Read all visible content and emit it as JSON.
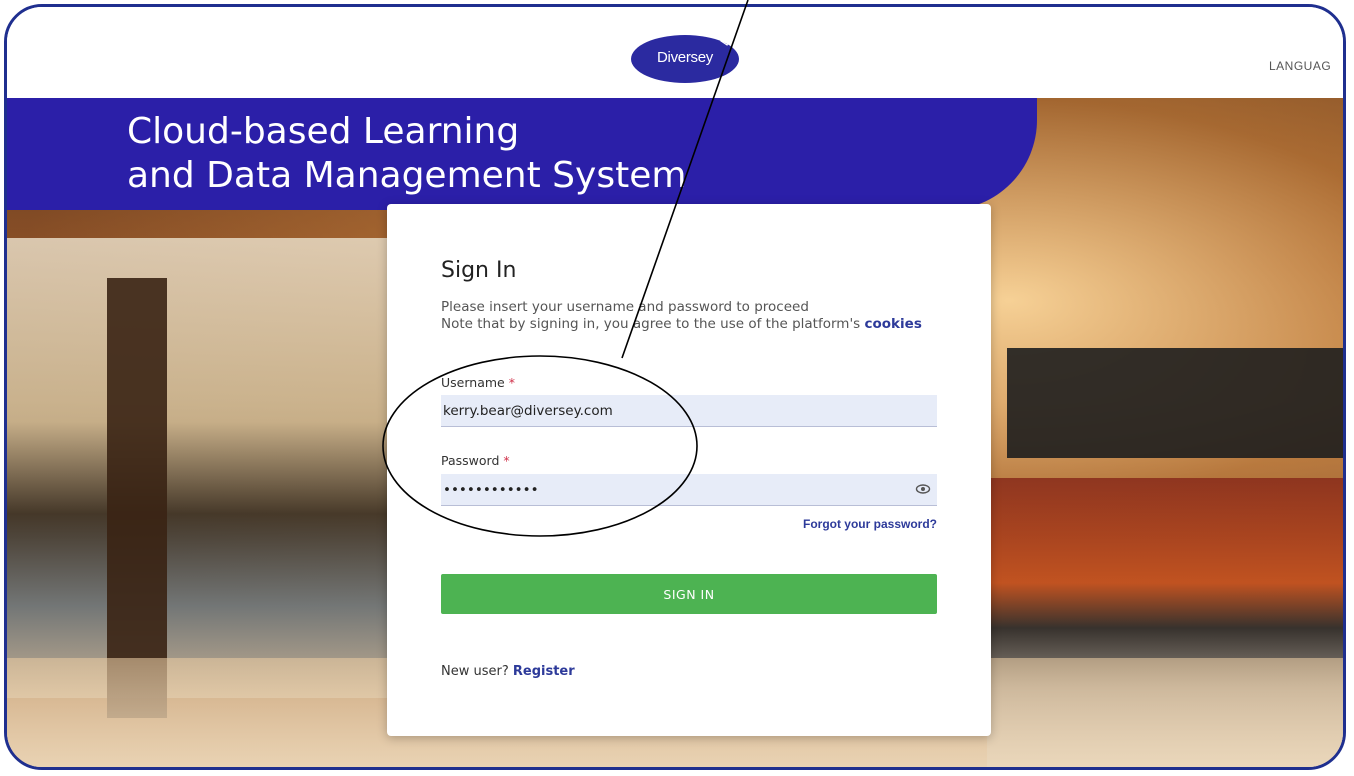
{
  "header": {
    "logo_text": "Diversey",
    "language_label": "LANGUAG"
  },
  "banner": {
    "title_line1": "Cloud-based Learning",
    "title_line2": "and Data Management System"
  },
  "signin_card": {
    "title": "Sign In",
    "desc_line1": "Please insert your username and password to proceed",
    "desc_line2_prefix": "Note that by signing in, you agree to the use of the platform's ",
    "cookies_link": "cookies",
    "username_label": "Username",
    "required_marker": "*",
    "username_value": "kerry.bear@diversey.com",
    "password_label": "Password",
    "password_value": "••••••••••••",
    "forgot_link": "Forgot your password?",
    "signin_button": "SIGN IN",
    "new_user_text": "New user? ",
    "register_link": "Register"
  },
  "colors": {
    "brand_blue": "#2b1fa8",
    "button_green": "#4db352",
    "link_blue": "#2d3a9a",
    "required_red": "#d0314a",
    "frame_border": "#1f2f8f"
  },
  "icons": {
    "show_password": "eye-icon",
    "logo_bird": "bird-icon"
  }
}
